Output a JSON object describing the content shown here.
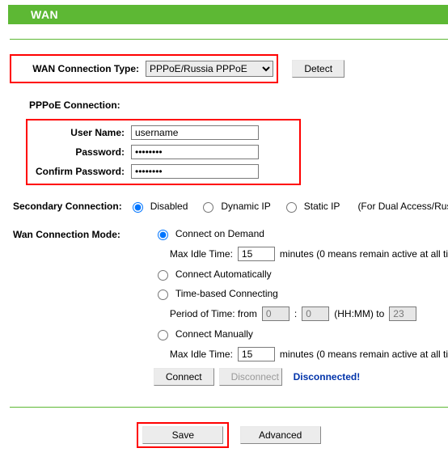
{
  "header": {
    "title": "WAN"
  },
  "wan_type": {
    "label": "WAN Connection Type:",
    "selected": "PPPoE/Russia PPPoE",
    "detect": "Detect"
  },
  "pppoe": {
    "section": "PPPoE Connection:",
    "user_label": "User Name:",
    "user_value": "username",
    "pass_label": "Password:",
    "pass_value": "********",
    "conf_label": "Confirm Password:",
    "conf_value": "********"
  },
  "secondary": {
    "label": "Secondary Connection:",
    "disabled": "Disabled",
    "dynamic": "Dynamic IP",
    "static": "Static IP",
    "hint": "(For Dual Access/Russia"
  },
  "mode": {
    "label": "Wan Connection Mode:",
    "on_demand": "Connect on Demand",
    "max_idle": "Max Idle Time:",
    "idle_value1": "15",
    "idle_unit": "minutes (0 means remain active at all ti",
    "auto": "Connect Automatically",
    "time_based": "Time-based Connecting",
    "period_from": "Period of Time: from",
    "p_from_val": "0",
    "colon": ":",
    "p_to_val": "0",
    "hhmm_to": "(HH:MM) to",
    "p_end_val": "23",
    "manual": "Connect Manually",
    "idle_value2": "15",
    "connect": "Connect",
    "disconnect": "Disconnect",
    "status": "Disconnected!"
  },
  "footer": {
    "save": "Save",
    "advanced": "Advanced"
  }
}
